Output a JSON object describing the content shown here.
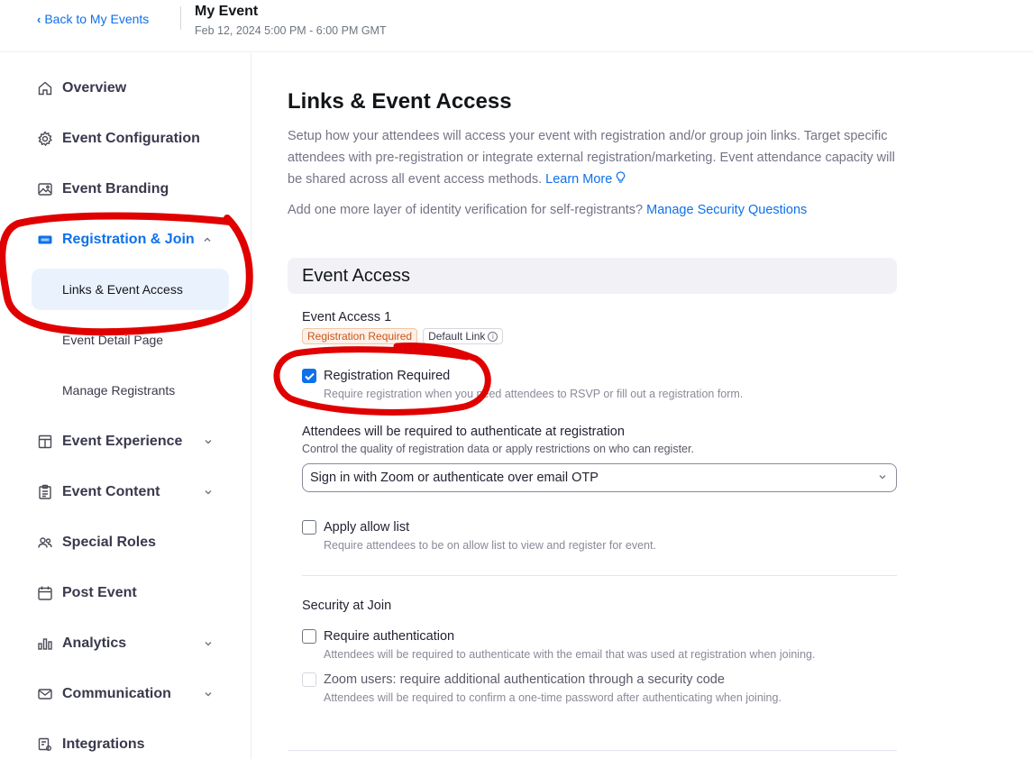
{
  "header": {
    "back_label": "Back to My Events",
    "event_title": "My Event",
    "event_date": "Feb 12, 2024 5:00 PM - 6:00 PM GMT"
  },
  "sidebar": {
    "items": [
      {
        "label": "Overview",
        "icon": "home-icon"
      },
      {
        "label": "Event Configuration",
        "icon": "gear-icon"
      },
      {
        "label": "Event Branding",
        "icon": "image-icon"
      },
      {
        "label": "Registration & Join",
        "icon": "ticket-icon",
        "active": true,
        "expanded": true
      },
      {
        "label": "Event Experience",
        "icon": "layout-icon"
      },
      {
        "label": "Event Content",
        "icon": "clipboard-icon"
      },
      {
        "label": "Special Roles",
        "icon": "people-icon"
      },
      {
        "label": "Post Event",
        "icon": "calendar-icon"
      },
      {
        "label": "Analytics",
        "icon": "bar-chart-icon"
      },
      {
        "label": "Communication",
        "icon": "mail-icon"
      },
      {
        "label": "Integrations",
        "icon": "integrations-icon"
      }
    ],
    "sub_items": [
      {
        "label": "Links & Event Access",
        "selected": true
      },
      {
        "label": "Event Detail Page"
      },
      {
        "label": "Manage Registrants"
      }
    ]
  },
  "main": {
    "title": "Links & Event Access",
    "description": "Setup how your attendees will access your event with registration and/or group join links. Target specific attendees with pre-registration or integrate external registration/marketing. Event attendance capacity will be shared across all event access methods.",
    "learn_more": "Learn More",
    "verify_text": "Add one more layer of identity verification for self-registrants?",
    "verify_link": "Manage Security Questions",
    "section_title": "Event Access",
    "access_label": "Event Access 1",
    "badge_registration": "Registration Required",
    "badge_default": "Default Link",
    "registration_required": {
      "label": "Registration Required",
      "help": "Require registration when you need attendees to RSVP or fill out a registration form.",
      "checked": true
    },
    "auth_label": "Attendees will be required to authenticate at registration",
    "auth_sub": "Control the quality of registration data or apply restrictions on who can register.",
    "auth_select_value": "Sign in with Zoom or authenticate over email OTP",
    "allow_list": {
      "label": "Apply allow list",
      "help": "Require attendees to be on allow list to view and register for event.",
      "checked": false
    },
    "security_label": "Security at Join",
    "require_auth": {
      "label": "Require authentication",
      "help": "Attendees will be required to authenticate with the email that was used at registration when joining.",
      "checked": false
    },
    "zoom_users": {
      "label": "Zoom users: require additional authentication through a security code",
      "help": "Attendees will be required to confirm a one-time password after authenticating when joining.",
      "checked": false,
      "disabled": true
    }
  },
  "colors": {
    "accent": "#0e71eb",
    "annotation": "#e00000"
  }
}
